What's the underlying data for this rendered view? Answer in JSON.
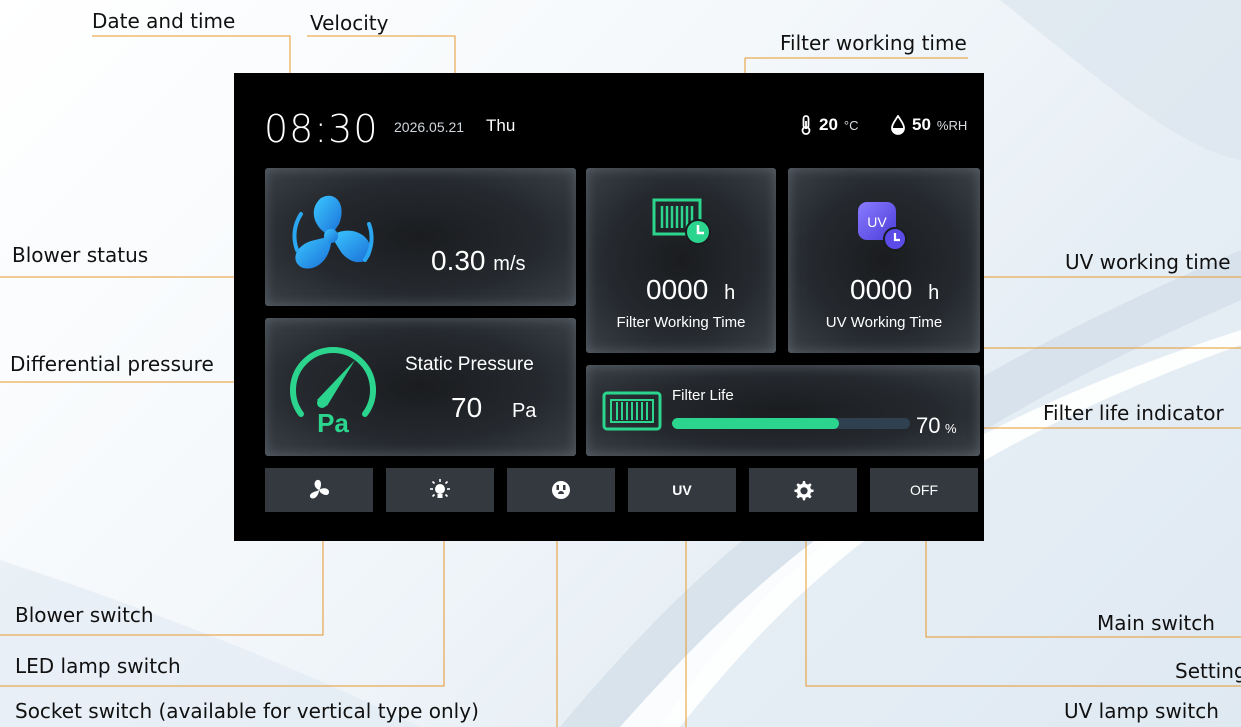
{
  "callouts": {
    "date_time": "Date and time",
    "velocity": "Velocity",
    "filter_working_time": "Filter working time",
    "blower_status": "Blower status",
    "uv_working_time": "UV working time",
    "differential_pressure": "Differential pressure",
    "filter_life_indicator": "Filter life indicator",
    "blower_switch": "Blower switch",
    "led_lamp_switch": "LED lamp switch",
    "socket_switch": "Socket switch (available for vertical type only)",
    "main_switch": "Main switch",
    "setting": "Setting",
    "uv_lamp_switch": "UV lamp switch"
  },
  "status_bar": {
    "time": "08:30",
    "date": "2026.05.21",
    "weekday": "Thu",
    "temperature": "20",
    "temperature_unit": "°C",
    "humidity": "50",
    "humidity_unit": "%RH"
  },
  "velocity": {
    "value": "0.30",
    "unit": "m/s"
  },
  "filter_time": {
    "value": "0000",
    "unit": "h",
    "label": "Filter Working Time"
  },
  "uv_time": {
    "value": "0000",
    "unit": "h",
    "label": "UV Working Time",
    "icon_text": "UV"
  },
  "pressure": {
    "label": "Static Pressure",
    "value": "70",
    "unit": "Pa",
    "icon_text": "Pa"
  },
  "filter_life": {
    "label": "Filter Life",
    "value": "70",
    "unit": "%",
    "percent": 70
  },
  "buttons": {
    "uv_label": "UV",
    "main_label": "OFF"
  },
  "colors": {
    "accent_blue": "#2aa7f0",
    "accent_green": "#2bd58e",
    "uv_purple": "#6a5cf0",
    "callout_line": "#e8982c"
  }
}
